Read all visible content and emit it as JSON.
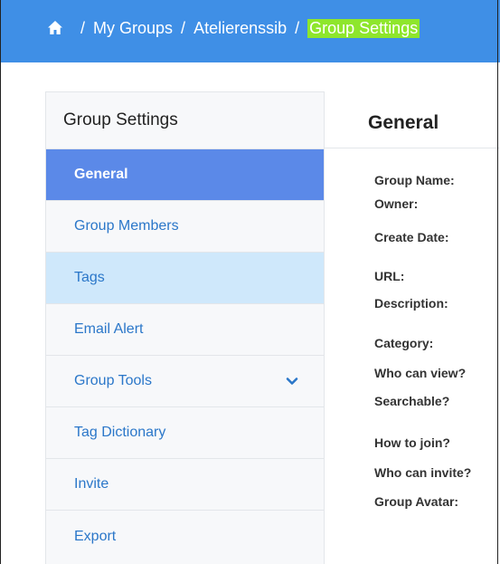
{
  "breadcrumb": {
    "home_icon": "home-icon",
    "separator": "/",
    "items": [
      "My Groups",
      "Atelierenssib",
      "Group Settings"
    ],
    "highlight_color": "#8ee62c"
  },
  "sidebar": {
    "title": "Group Settings",
    "items": [
      {
        "label": "General",
        "state": "active"
      },
      {
        "label": "Group Members",
        "state": "normal"
      },
      {
        "label": "Tags",
        "state": "hover"
      },
      {
        "label": "Email Alert",
        "state": "normal"
      },
      {
        "label": "Group Tools",
        "state": "normal",
        "icon": "chevron-down-icon"
      },
      {
        "label": "Tag Dictionary",
        "state": "normal"
      },
      {
        "label": "Invite",
        "state": "normal"
      },
      {
        "label": "Export",
        "state": "normal"
      }
    ]
  },
  "main": {
    "title": "General",
    "fields": [
      "Group Name:",
      "Owner:",
      "Create Date:",
      "URL:",
      "Description:",
      "Category:",
      "Who can view?",
      "Searchable?",
      "How to join?",
      "Who can invite?",
      "Group Avatar:"
    ]
  },
  "colors": {
    "topbar": "#3f8fe6",
    "active_item": "#5b89e8",
    "hover_item": "#cfe8fb",
    "link": "#2b77c9"
  }
}
